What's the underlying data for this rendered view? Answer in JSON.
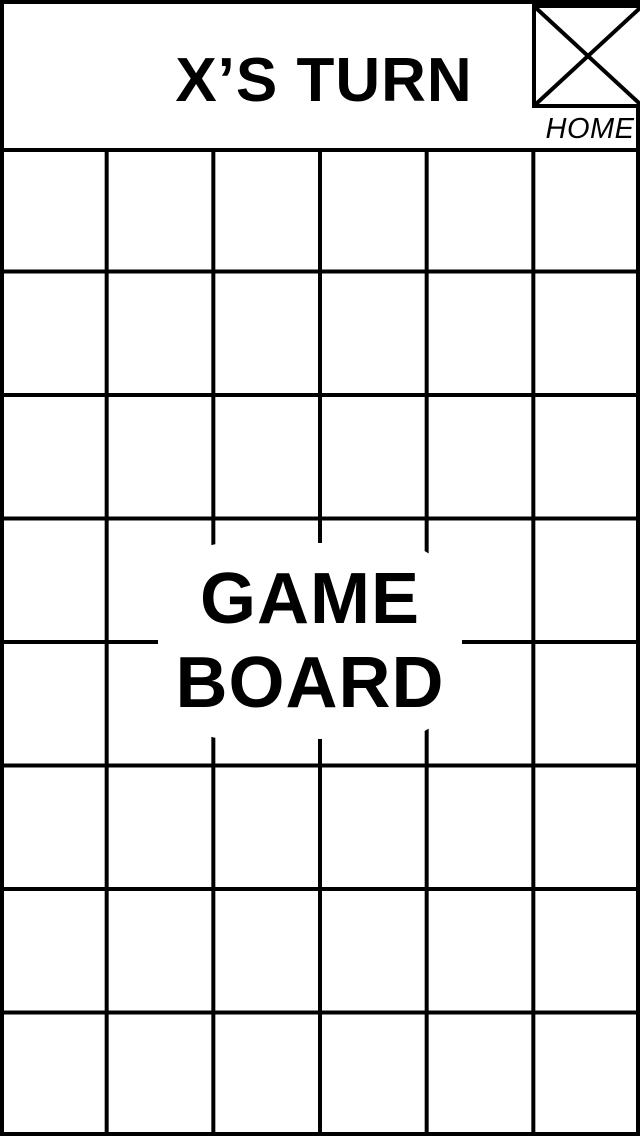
{
  "header": {
    "turn_text": "X’S TURN",
    "home_label": "HOME",
    "home_icon": "x-box-icon"
  },
  "board": {
    "rows": 8,
    "columns": 6,
    "label_line1": "GAME",
    "label_line2": "BOARD"
  },
  "colors": {
    "background": "#ffffff",
    "lines": "#000000"
  }
}
